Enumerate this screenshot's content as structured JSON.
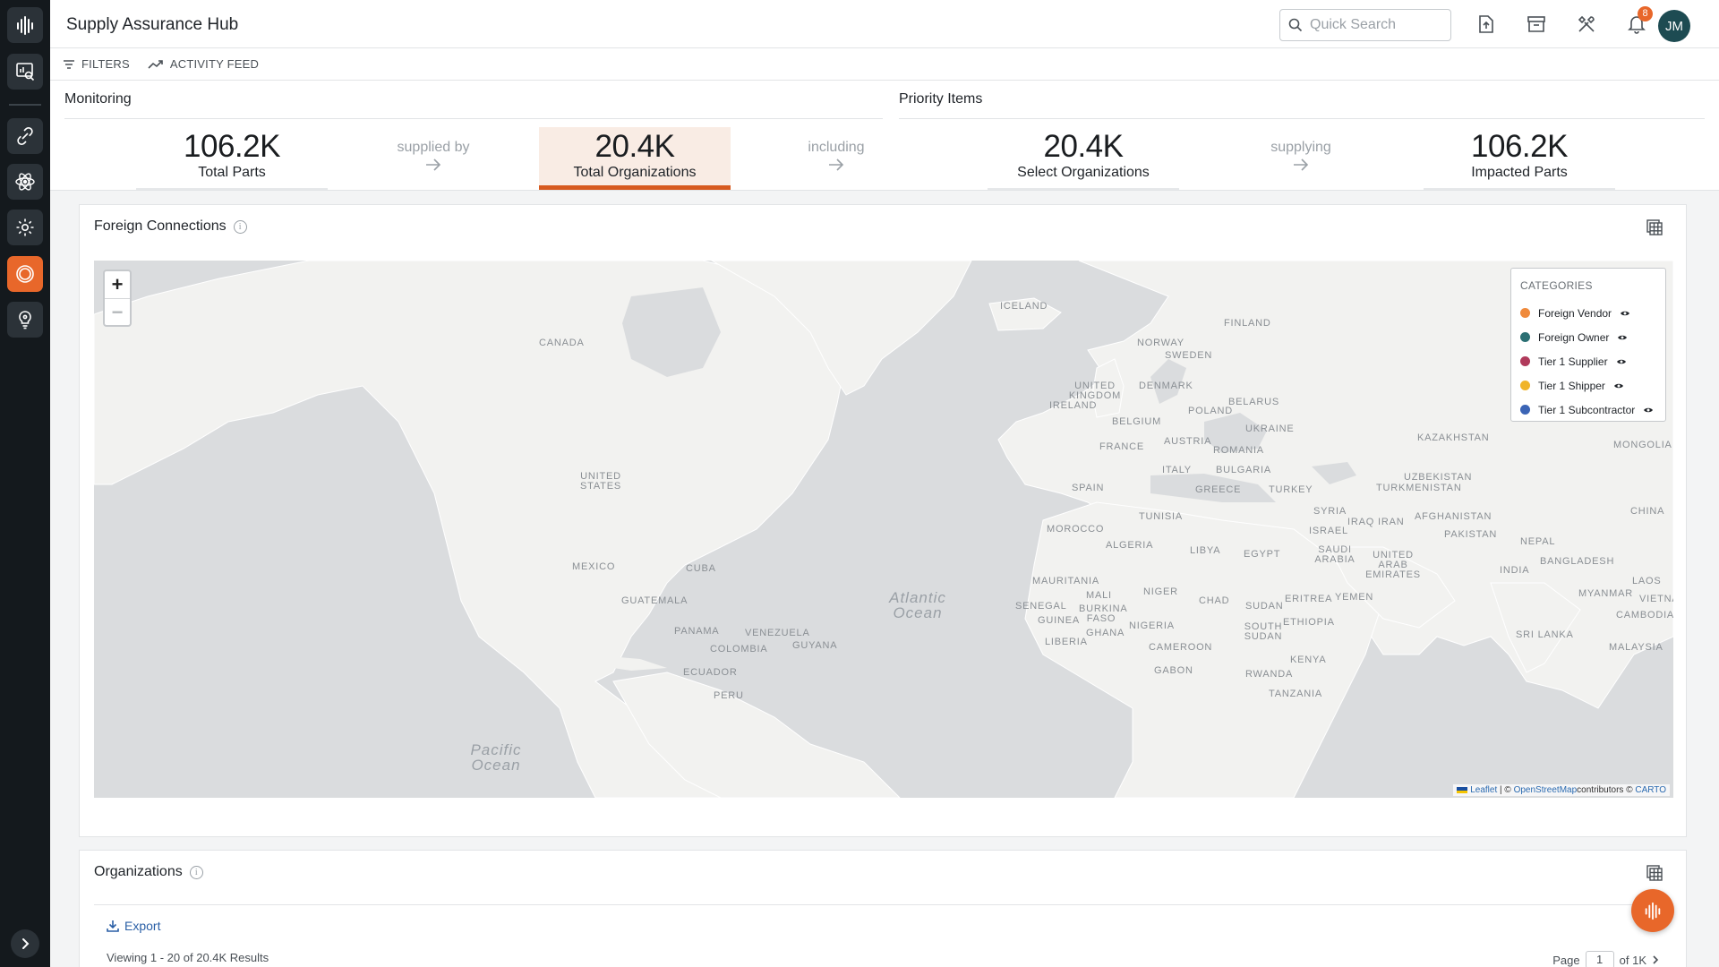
{
  "app": {
    "title": "Supply Assurance Hub"
  },
  "header": {
    "search_placeholder": "Quick Search",
    "notification_count": "8",
    "avatar_initials": "JM"
  },
  "toolbar": {
    "filters_label": "FILTERS",
    "activity_label": "ACTIVITY FEED"
  },
  "monitoring": {
    "label": "Monitoring",
    "stats": [
      {
        "value": "106.2K",
        "label": "Total Parts"
      },
      {
        "value": "20.4K",
        "label": "Total Organizations"
      }
    ],
    "connectors": [
      "supplied by",
      "including"
    ]
  },
  "priority": {
    "label": "Priority Items",
    "stats": [
      {
        "value": "20.4K",
        "label": "Select Organizations"
      },
      {
        "value": "106.2K",
        "label": "Impacted Parts"
      }
    ],
    "connector": "supplying"
  },
  "foreign_connections": {
    "title": "Foreign Connections",
    "legend": {
      "title": "CATEGORIES",
      "items": [
        {
          "label": "Foreign Vendor",
          "color": "#ef8a3c"
        },
        {
          "label": "Foreign Owner",
          "color": "#2b6f73"
        },
        {
          "label": "Tier 1 Supplier",
          "color": "#b03a5b"
        },
        {
          "label": "Tier 1 Shipper",
          "color": "#f0b429"
        },
        {
          "label": "Tier 1 Subcontractor",
          "color": "#3b64b5"
        }
      ]
    },
    "attribution": {
      "leaflet": "Leaflet",
      "osm": "OpenStreetMap",
      "contributors": "contributors ©",
      "carto": "CARTO"
    },
    "map_labels": {
      "canada": "CANADA",
      "iceland": "ICELAND",
      "finland": "FINLAND",
      "norway": "NORWAY",
      "sweden": "SWEDEN",
      "uk": "UNITED KINGDOM",
      "ireland": "IRELAND",
      "denmark": "DENMARK",
      "belarus": "BELARUS",
      "poland": "POLAND",
      "belgium": "BELGIUM",
      "ukraine": "UKRAINE",
      "kazakhstan": "KAZAKHSTAN",
      "mongolia": "MONGOLIA",
      "france": "FRANCE",
      "austria": "AUSTRIA",
      "romania": "ROMANIA",
      "italy": "ITALY",
      "bulgaria": "BULGARIA",
      "usa": "UNITED STATES",
      "spain": "SPAIN",
      "greece": "GREECE",
      "turkey": "TURKEY",
      "uzbekistan": "UZBEKISTAN",
      "turkmenistan": "TURKMENISTAN",
      "tunisia": "TUNISIA",
      "syria": "SYRIA",
      "iraq": "IRAQ",
      "iran": "IRAN",
      "afghanistan": "AFGHANISTAN",
      "china": "CHINA",
      "morocco": "MOROCCO",
      "israel": "ISRAEL",
      "pakistan": "PAKISTAN",
      "algeria": "ALGERIA",
      "libya": "LIBYA",
      "egypt": "EGYPT",
      "saudi": "SAUDI ARABIA",
      "uae": "UNITED ARAB EMIRATES",
      "nepal": "NEPAL",
      "bangladesh": "BANGLADESH",
      "india": "INDIA",
      "mexico": "MEXICO",
      "cuba": "CUBA",
      "mauritania": "MAURITANIA",
      "mali": "MALI",
      "niger": "NIGER",
      "chad": "CHAD",
      "sudan": "SUDAN",
      "eritrea": "ERITREA",
      "yemen": "YEMEN",
      "myanmar": "MYANMAR",
      "laos": "LAOS",
      "vietnam": "VIETNAM",
      "guatemala": "GUATEMALA",
      "senegal": "SENEGAL",
      "burkina": "BURKINA FASO",
      "guinea": "GUINEA",
      "nigeria": "NIGERIA",
      "ethiopia": "ETHIOPIA",
      "cambodia": "CAMBODIA",
      "panama": "PANAMA",
      "venezuela": "VENEZUELA",
      "ghana": "GHANA",
      "liberia": "LIBERIA",
      "south_sudan": "SOUTH SUDAN",
      "sri_lanka": "SRI LANKA",
      "colombia": "COLOMBIA",
      "guyana": "GUYANA",
      "cameroon": "CAMEROON",
      "malaysia": "MALAYSIA",
      "kenya": "KENYA",
      "gabon": "GABON",
      "ecuador": "ECUADOR",
      "rwanda": "RWANDA",
      "peru": "PERU",
      "tanzania": "TANZANIA"
    },
    "oceans": {
      "atlantic": "Atlantic Ocean",
      "pacific": "Pacific Ocean"
    }
  },
  "organizations": {
    "title": "Organizations",
    "export_label": "Export",
    "viewing_text": "Viewing 1 - 20 of 20.4K Results",
    "page_label": "Page",
    "page_value": "1",
    "page_total": "of 1K"
  }
}
